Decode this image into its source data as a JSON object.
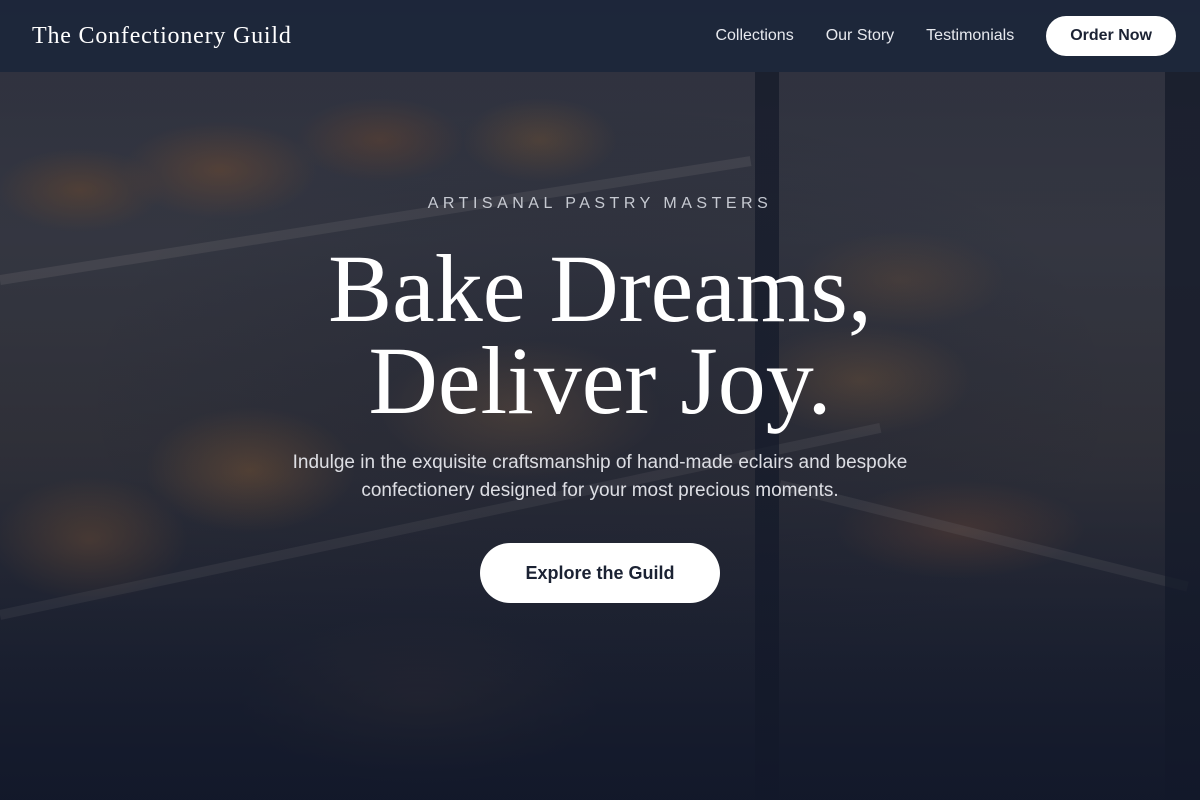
{
  "header": {
    "brand": "The Confectionery Guild",
    "nav": [
      {
        "label": "Collections"
      },
      {
        "label": "Our Story"
      },
      {
        "label": "Testimonials"
      }
    ],
    "cta_label": "Order Now"
  },
  "hero": {
    "eyebrow": "ARTISANAL PASTRY MASTERS",
    "headline_line1": "Bake Dreams,",
    "headline_line2": "Deliver Joy.",
    "subtext": "Indulge in the exquisite craftsmanship of hand-made eclairs and bespoke confectionery designed for your most precious moments.",
    "cta_label": "Explore the Guild",
    "background_image": "bakery display case with pastries and breads"
  },
  "colors": {
    "nav_background": "#1c263a",
    "button_background": "#ffffff",
    "button_text": "#1b2233",
    "heading_text": "#ffffff"
  }
}
